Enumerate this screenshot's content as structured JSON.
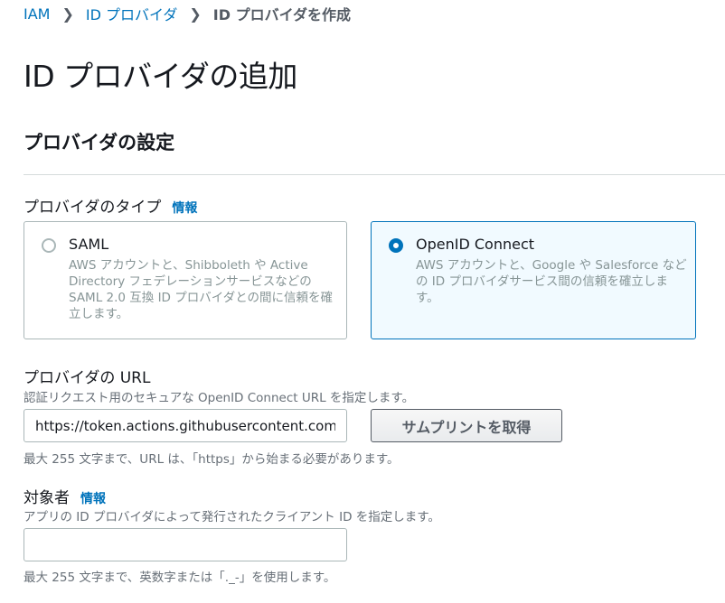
{
  "breadcrumb": {
    "items": [
      "IAM",
      "ID プロバイダ"
    ],
    "current": "ID プロバイダを作成",
    "separator": "❯"
  },
  "page": {
    "title": "ID プロバイダの追加"
  },
  "section": {
    "title": "プロバイダの設定"
  },
  "provider_type": {
    "label": "プロバイダのタイプ",
    "info": "情報",
    "options": [
      {
        "title": "SAML",
        "description": "AWS アカウントと、Shibboleth や Active Directory フェデレーションサービスなどの SAML 2.0 互換 ID プロバイダとの間に信頼を確立します。",
        "selected": false
      },
      {
        "title": "OpenID Connect",
        "description": "AWS アカウントと、Google や Salesforce などの ID プロバイダサービス間の信頼を確立します。",
        "selected": true
      }
    ]
  },
  "provider_url": {
    "label": "プロバイダの URL",
    "description": "認証リクエスト用のセキュアな OpenID Connect URL を指定します。",
    "value": "https://token.actions.githubusercontent.com",
    "button_label": "サムプリントを取得",
    "hint": "最大 255 文字まで、URL は、「https」から始まる必要があります。"
  },
  "audience": {
    "label": "対象者",
    "info": "情報",
    "description": "アプリの ID プロバイダによって発行されたクライアント ID を指定します。",
    "value": "",
    "hint": "最大 255 文字まで、英数字または「._-」を使用します。"
  }
}
